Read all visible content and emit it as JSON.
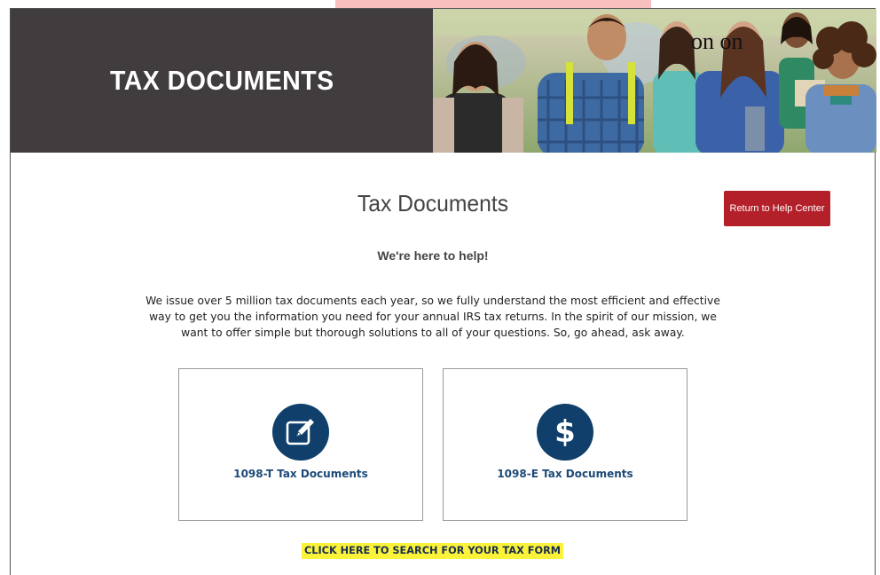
{
  "hero": {
    "title": "TAX DOCUMENTS",
    "overlay_text": "on on"
  },
  "main": {
    "title": "Tax Documents",
    "return_button_label": "Return to Help Center",
    "subtitle": "We're here to help!",
    "intro": "We issue over 5 million tax documents each year, so we fully understand the most efficient and effective way to get you the information you need for your annual IRS tax returns. In the spirit of our mission, we want to offer simple but thorough solutions to all of your questions. So, go ahead, ask away.",
    "cards": [
      {
        "label": "1098-T Tax Documents",
        "icon": "edit-icon"
      },
      {
        "label": "1098-E Tax Documents",
        "icon": "dollar-icon",
        "icon_glyph": "$"
      }
    ],
    "search_link": "CLICK HERE TO SEARCH FOR YOUR TAX FORM"
  },
  "colors": {
    "hero_bg": "#413d3f",
    "accent_red": "#b3202a",
    "icon_circle": "#0f3f6a",
    "link_blue": "#1d4a78",
    "highlight_yellow": "#fbf33a"
  }
}
